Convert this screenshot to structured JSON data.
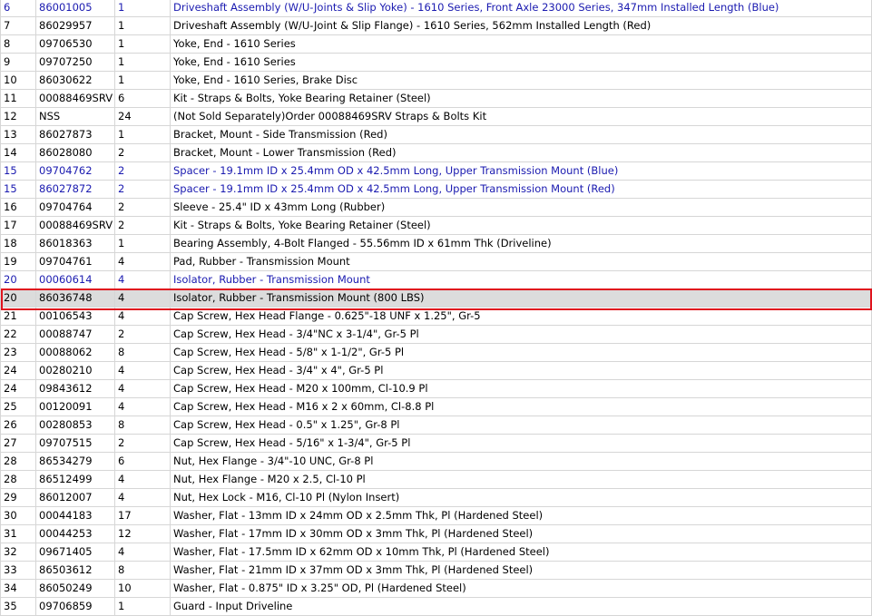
{
  "colors": {
    "link_text": "#1a1ab0",
    "selected_row_bg": "#dcdcdc",
    "selection_outline": "#e0141e",
    "grid_line": "#d6d6d6"
  },
  "rows": [
    {
      "ref": "6",
      "part": "86001005",
      "qty": "1",
      "desc": "Driveshaft Assembly (W/U-Joints & Slip Yoke) - 1610 Series, Front Axle 23000 Series, 347mm Installed Length (Blue)",
      "link": true
    },
    {
      "ref": "7",
      "part": "86029957",
      "qty": "1",
      "desc": "Driveshaft Assembly (W/U-Joint & Slip Flange) - 1610 Series, 562mm Installed Length (Red)"
    },
    {
      "ref": "8",
      "part": "09706530",
      "qty": "1",
      "desc": "Yoke, End - 1610 Series"
    },
    {
      "ref": "9",
      "part": "09707250",
      "qty": "1",
      "desc": "Yoke, End - 1610 Series"
    },
    {
      "ref": "10",
      "part": "86030622",
      "qty": "1",
      "desc": "Yoke, End - 1610 Series, Brake Disc"
    },
    {
      "ref": "11",
      "part": "00088469SRV",
      "qty": "6",
      "desc": "Kit - Straps & Bolts, Yoke Bearing Retainer (Steel)"
    },
    {
      "ref": "12",
      "part": "NSS",
      "qty": "24",
      "desc": "(Not Sold Separately)Order 00088469SRV Straps & Bolts Kit"
    },
    {
      "ref": "13",
      "part": "86027873",
      "qty": "1",
      "desc": "Bracket, Mount - Side Transmission (Red)"
    },
    {
      "ref": "14",
      "part": "86028080",
      "qty": "2",
      "desc": "Bracket, Mount - Lower Transmission (Red)"
    },
    {
      "ref": "15",
      "part": "09704762",
      "qty": "2",
      "desc": "Spacer - 19.1mm ID x 25.4mm OD x 42.5mm Long, Upper Transmission Mount (Blue)",
      "link": true
    },
    {
      "ref": "15",
      "part": "86027872",
      "qty": "2",
      "desc": "Spacer - 19.1mm ID x 25.4mm OD x 42.5mm Long, Upper Transmission Mount (Red)",
      "link": true
    },
    {
      "ref": "16",
      "part": "09704764",
      "qty": "2",
      "desc": "Sleeve - 25.4\" ID x 43mm Long (Rubber)"
    },
    {
      "ref": "17",
      "part": "00088469SRV",
      "qty": "2",
      "desc": "Kit - Straps & Bolts, Yoke Bearing Retainer (Steel)"
    },
    {
      "ref": "18",
      "part": "86018363",
      "qty": "1",
      "desc": "Bearing Assembly, 4-Bolt Flanged - 55.56mm ID x 61mm Thk (Driveline)"
    },
    {
      "ref": "19",
      "part": "09704761",
      "qty": "4",
      "desc": "Pad, Rubber - Transmission Mount"
    },
    {
      "ref": "20",
      "part": "00060614",
      "qty": "4",
      "desc": "Isolator, Rubber - Transmission Mount",
      "link": true
    },
    {
      "ref": "20",
      "part": "86036748",
      "qty": "4",
      "desc": "Isolator, Rubber - Transmission Mount (800 LBS)",
      "selected": true
    },
    {
      "ref": "21",
      "part": "00106543",
      "qty": "4",
      "desc": "Cap Screw, Hex Head Flange - 0.625\"-18 UNF x 1.25\", Gr-5"
    },
    {
      "ref": "22",
      "part": "00088747",
      "qty": "2",
      "desc": "Cap Screw, Hex Head - 3/4\"NC x 3-1/4\", Gr-5 Pl"
    },
    {
      "ref": "23",
      "part": "00088062",
      "qty": "8",
      "desc": "Cap Screw, Hex Head - 5/8\" x 1-1/2\", Gr-5 Pl"
    },
    {
      "ref": "24",
      "part": "00280210",
      "qty": "4",
      "desc": "Cap Screw, Hex Head - 3/4\" x 4\", Gr-5 Pl"
    },
    {
      "ref": "24",
      "part": "09843612",
      "qty": "4",
      "desc": "Cap Screw, Hex Head - M20 x 100mm, Cl-10.9 Pl"
    },
    {
      "ref": "25",
      "part": "00120091",
      "qty": "4",
      "desc": "Cap Screw, Hex Head - M16 x 2 x 60mm, Cl-8.8 Pl"
    },
    {
      "ref": "26",
      "part": "00280853",
      "qty": "8",
      "desc": "Cap Screw, Hex Head - 0.5\" x 1.25\", Gr-8 Pl"
    },
    {
      "ref": "27",
      "part": "09707515",
      "qty": "2",
      "desc": "Cap Screw, Hex Head - 5/16\" x 1-3/4\", Gr-5 Pl"
    },
    {
      "ref": "28",
      "part": "86534279",
      "qty": "6",
      "desc": "Nut, Hex Flange - 3/4\"-10 UNC, Gr-8 Pl"
    },
    {
      "ref": "28",
      "part": "86512499",
      "qty": "4",
      "desc": "Nut, Hex Flange - M20 x 2.5, Cl-10 Pl"
    },
    {
      "ref": "29",
      "part": "86012007",
      "qty": "4",
      "desc": "Nut, Hex Lock - M16, Cl-10 Pl (Nylon Insert)"
    },
    {
      "ref": "30",
      "part": "00044183",
      "qty": "17",
      "desc": "Washer, Flat - 13mm ID x 24mm OD x 2.5mm Thk, Pl (Hardened Steel)"
    },
    {
      "ref": "31",
      "part": "00044253",
      "qty": "12",
      "desc": "Washer, Flat - 17mm ID x 30mm OD x 3mm Thk, Pl (Hardened Steel)"
    },
    {
      "ref": "32",
      "part": "09671405",
      "qty": "4",
      "desc": "Washer, Flat - 17.5mm ID x 62mm OD x 10mm Thk, Pl (Hardened Steel)"
    },
    {
      "ref": "33",
      "part": "86503612",
      "qty": "8",
      "desc": "Washer, Flat - 21mm ID x 37mm OD x 3mm Thk, Pl (Hardened Steel)"
    },
    {
      "ref": "34",
      "part": "86050249",
      "qty": "10",
      "desc": "Washer, Flat - 0.875\" ID x 3.25\" OD, Pl (Hardened Steel)"
    },
    {
      "ref": "35",
      "part": "09706859",
      "qty": "1",
      "desc": "Guard - Input Driveline"
    }
  ]
}
